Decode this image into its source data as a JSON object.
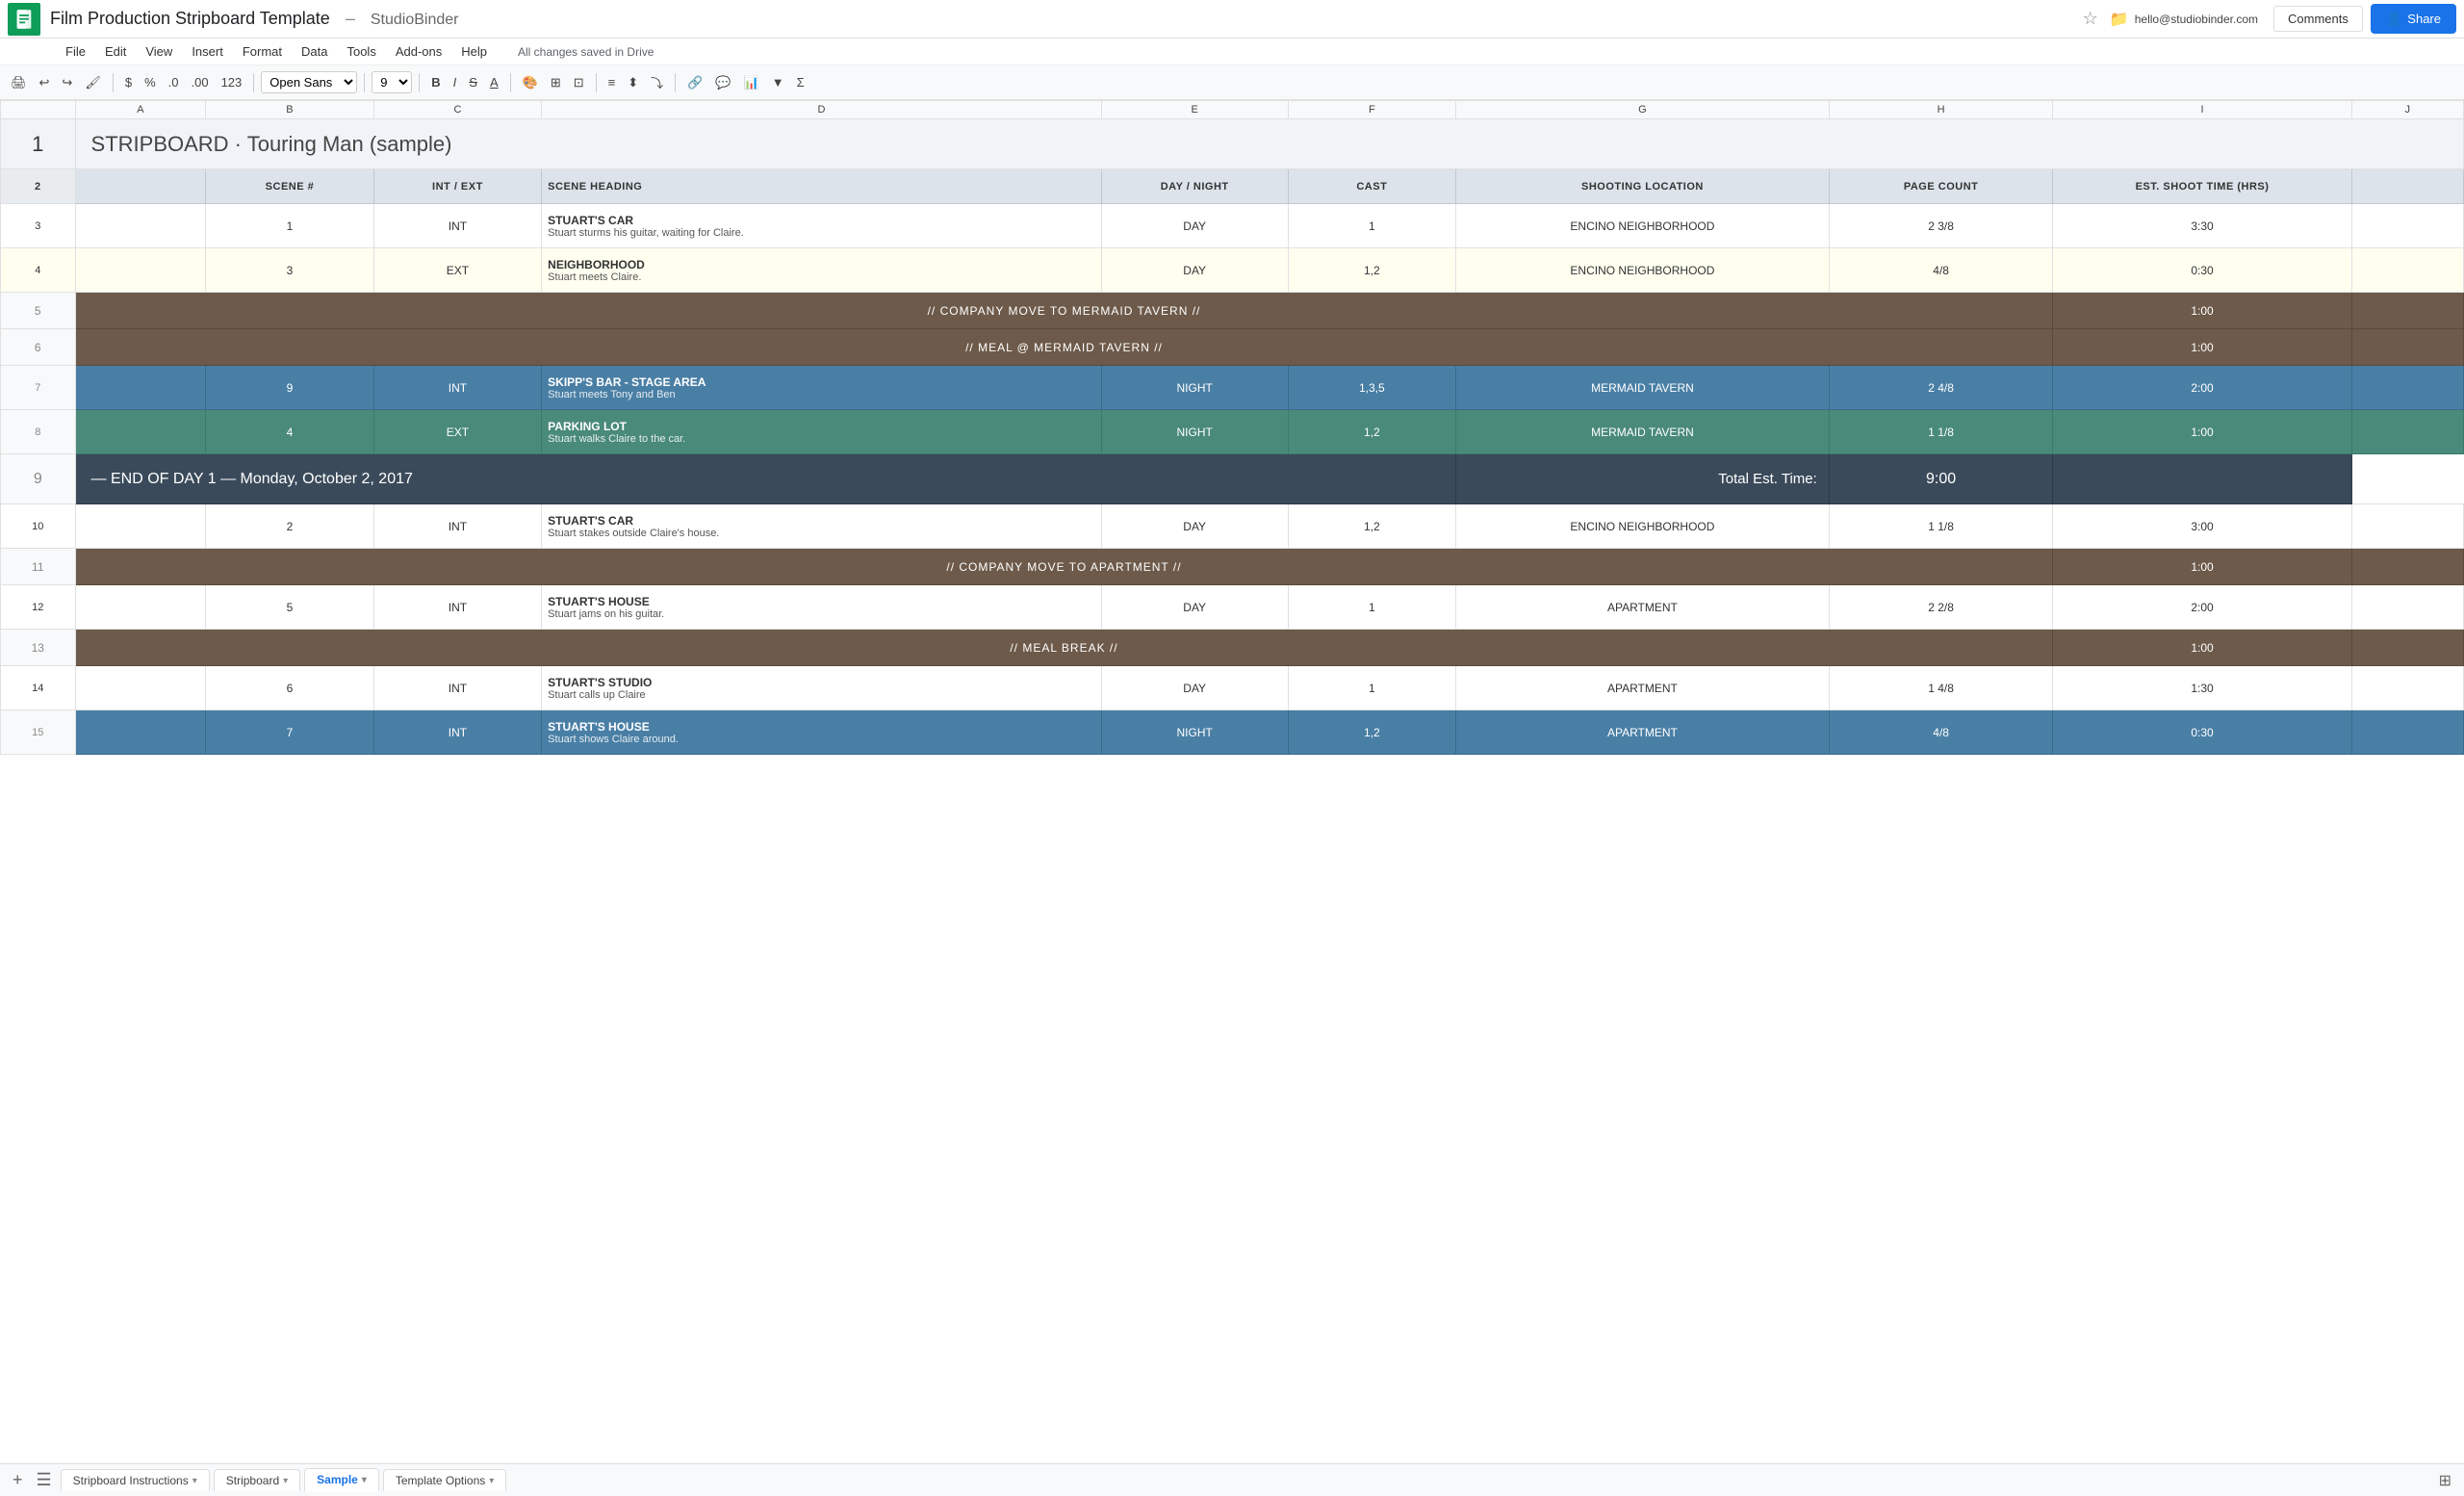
{
  "app": {
    "logo_alt": "Google Sheets",
    "doc_title": "Film Production Stripboard Template",
    "separator": "–",
    "brand": "StudioBinder",
    "star_icon": "☆",
    "folder_icon": "🗁",
    "user_email": "hello@studiobinder.com",
    "comments_label": "Comments",
    "share_label": "Share"
  },
  "menu": {
    "items": [
      "File",
      "Edit",
      "View",
      "Insert",
      "Format",
      "Data",
      "Tools",
      "Add-ons",
      "Help"
    ],
    "autosave": "All changes saved in Drive"
  },
  "toolbar": {
    "font_family": "Open Sans",
    "font_size": "9",
    "bold": "B",
    "italic": "I",
    "strikethrough": "S",
    "underline": "U"
  },
  "columns": {
    "headers": [
      "A",
      "B",
      "C",
      "D",
      "E",
      "F",
      "G",
      "H",
      "I",
      "J"
    ],
    "widths": [
      40,
      70,
      90,
      300,
      100,
      90,
      200,
      120,
      160,
      60
    ]
  },
  "sheet": {
    "title_row": {
      "row_num": "1",
      "text": "STRIPBOARD · Touring Man (sample)"
    },
    "header_row": {
      "row_num": "2",
      "cols": [
        "",
        "SCENE #",
        "INT / EXT",
        "SCENE HEADING",
        "DAY / NIGHT",
        "CAST",
        "SHOOTING LOCATION",
        "PAGE COUNT",
        "EST. SHOOT TIME (HRS)",
        ""
      ]
    },
    "rows": [
      {
        "row_num": "3",
        "type": "normal",
        "scene_num": "1",
        "int_ext": "INT",
        "heading": "STUART'S CAR",
        "desc": "Stuart sturms his guitar, waiting for Claire.",
        "day_night": "DAY",
        "cast": "1",
        "location": "ENCINO NEIGHBORHOOD",
        "page_count": "2 3/8",
        "shoot_time": "3:30"
      },
      {
        "row_num": "4",
        "type": "yellow",
        "scene_num": "3",
        "int_ext": "EXT",
        "heading": "NEIGHBORHOOD",
        "desc": "Stuart meets Claire.",
        "day_night": "DAY",
        "cast": "1,2",
        "location": "ENCINO NEIGHBORHOOD",
        "page_count": "4/8",
        "shoot_time": "0:30"
      },
      {
        "row_num": "5",
        "type": "brown",
        "text": "// COMPANY MOVE TO MERMAID TAVERN //",
        "shoot_time": "1:00"
      },
      {
        "row_num": "6",
        "type": "brown",
        "text": "// MEAL @ MERMAID TAVERN //",
        "shoot_time": "1:00"
      },
      {
        "row_num": "7",
        "type": "blue",
        "scene_num": "9",
        "int_ext": "INT",
        "heading": "SKIPP'S BAR - STAGE AREA",
        "desc": "Stuart meets Tony and Ben",
        "day_night": "NIGHT",
        "cast": "1,3,5",
        "location": "MERMAID TAVERN",
        "page_count": "2 4/8",
        "shoot_time": "2:00"
      },
      {
        "row_num": "8",
        "type": "teal",
        "scene_num": "4",
        "int_ext": "EXT",
        "heading": "PARKING LOT",
        "desc": "Stuart walks Claire to the car.",
        "day_night": "NIGHT",
        "cast": "1,2",
        "location": "MERMAID TAVERN",
        "page_count": "1 1/8",
        "shoot_time": "1:00"
      },
      {
        "row_num": "9",
        "type": "day_end",
        "text": "— END OF DAY 1 — Monday, October 2, 2017",
        "total_label": "Total Est. Time:",
        "total_time": "9:00"
      },
      {
        "row_num": "10",
        "type": "normal",
        "scene_num": "2",
        "int_ext": "INT",
        "heading": "STUART'S CAR",
        "desc": "Stuart stakes outside Claire's house.",
        "day_night": "DAY",
        "cast": "1,2",
        "location": "ENCINO NEIGHBORHOOD",
        "page_count": "1 1/8",
        "shoot_time": "3:00"
      },
      {
        "row_num": "11",
        "type": "brown",
        "text": "// COMPANY MOVE TO APARTMENT //",
        "shoot_time": "1:00"
      },
      {
        "row_num": "12",
        "type": "normal",
        "scene_num": "5",
        "int_ext": "INT",
        "heading": "STUART'S HOUSE",
        "desc": "Stuart jams on his guitar.",
        "day_night": "DAY",
        "cast": "1",
        "location": "APARTMENT",
        "page_count": "2 2/8",
        "shoot_time": "2:00"
      },
      {
        "row_num": "13",
        "type": "brown",
        "text": "// MEAL BREAK //",
        "shoot_time": "1:00"
      },
      {
        "row_num": "14",
        "type": "normal",
        "scene_num": "6",
        "int_ext": "INT",
        "heading": "STUART'S STUDIO",
        "desc": "Stuart calls up Claire",
        "day_night": "DAY",
        "cast": "1",
        "location": "APARTMENT",
        "page_count": "1 4/8",
        "shoot_time": "1:30"
      },
      {
        "row_num": "15",
        "type": "blue",
        "scene_num": "7",
        "int_ext": "INT",
        "heading": "STUART'S HOUSE",
        "desc": "Stuart shows Claire around.",
        "day_night": "NIGHT",
        "cast": "1,2",
        "location": "APARTMENT",
        "page_count": "4/8",
        "shoot_time": "0:30"
      }
    ]
  },
  "tabs": [
    {
      "label": "Stripboard Instructions",
      "active": false
    },
    {
      "label": "Stripboard",
      "active": false
    },
    {
      "label": "Sample",
      "active": true
    },
    {
      "label": "Template Options",
      "active": false
    }
  ]
}
